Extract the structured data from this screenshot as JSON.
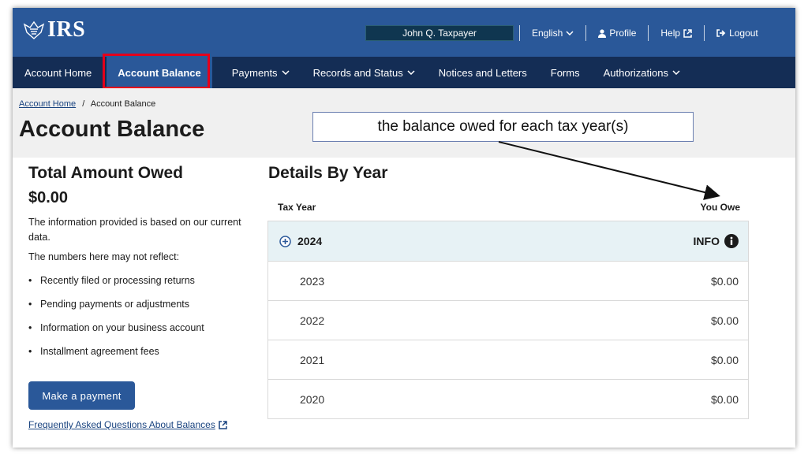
{
  "header": {
    "logo_text": "IRS",
    "user_name": "John Q. Taxpayer",
    "language": "English",
    "profile": "Profile",
    "help": "Help",
    "logout": "Logout"
  },
  "nav": {
    "items": [
      {
        "label": "Account Home"
      },
      {
        "label": "Account Balance"
      },
      {
        "label": "Payments"
      },
      {
        "label": "Records and Status"
      },
      {
        "label": "Notices and Letters"
      },
      {
        "label": "Forms"
      },
      {
        "label": "Authorizations"
      }
    ]
  },
  "breadcrumb": {
    "home": "Account Home",
    "separator": "/",
    "current": "Account Balance"
  },
  "page_title": "Account Balance",
  "annotation_text": "the balance owed for each tax year(s)",
  "summary": {
    "heading": "Total Amount Owed",
    "amount": "$0.00",
    "info_text": "The information provided is based on our current data.",
    "may_not_reflect": "The numbers here may not reflect:",
    "bullets": [
      "Recently filed or processing returns",
      "Pending payments or adjustments",
      "Information on your business account",
      "Installment agreement fees"
    ],
    "button": "Make a payment",
    "faq_link": "Frequently Asked Questions About Balances"
  },
  "details": {
    "heading": "Details By Year",
    "col_year": "Tax Year",
    "col_owe": "You Owe",
    "rows": [
      {
        "year": "2024",
        "owe": "INFO"
      },
      {
        "year": "2023",
        "owe": "$0.00"
      },
      {
        "year": "2022",
        "owe": "$0.00"
      },
      {
        "year": "2021",
        "owe": "$0.00"
      },
      {
        "year": "2020",
        "owe": "$0.00"
      }
    ]
  },
  "colors": {
    "header_blue": "#2a5899",
    "nav_navy": "#142d55",
    "highlight_red": "#e3001b",
    "row_highlight": "#e7f2f5"
  }
}
